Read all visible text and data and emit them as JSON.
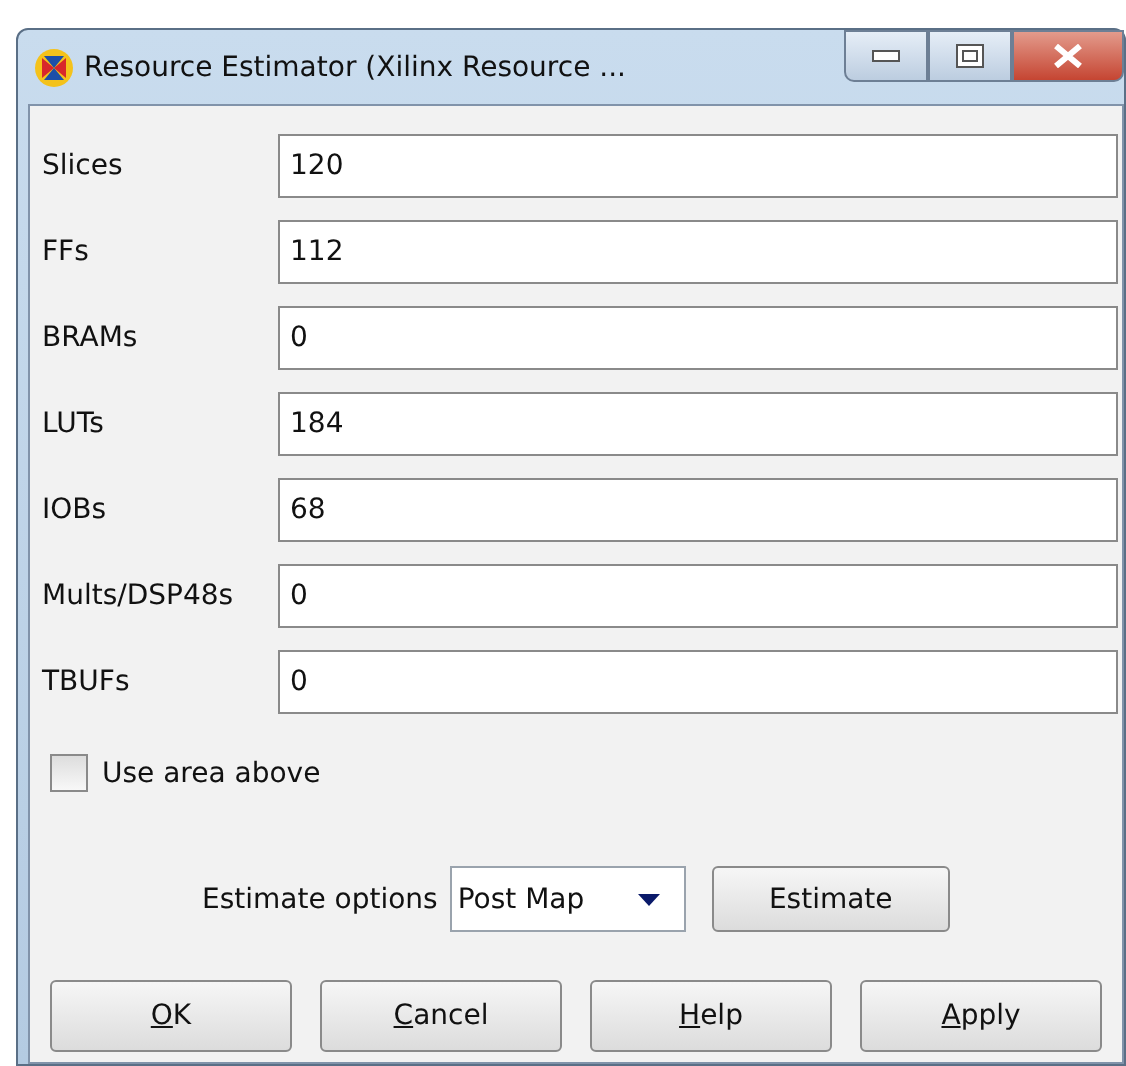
{
  "window": {
    "title": "Resource Estimator (Xilinx Resource ..."
  },
  "fields": [
    {
      "label": "Slices",
      "value": "120"
    },
    {
      "label": "FFs",
      "value": "112"
    },
    {
      "label": "BRAMs",
      "value": "0"
    },
    {
      "label": "LUTs",
      "value": "184"
    },
    {
      "label": "IOBs",
      "value": "68"
    },
    {
      "label": "Mults/DSP48s",
      "value": "0"
    },
    {
      "label": "TBUFs",
      "value": "0"
    }
  ],
  "use_area_above": {
    "label": "Use area above",
    "checked": false
  },
  "estimate_options": {
    "label": "Estimate options",
    "value": "Post Map",
    "button": "Estimate"
  },
  "buttons": [
    {
      "mnemonic": "O",
      "rest": "K"
    },
    {
      "mnemonic": "C",
      "rest": "ancel"
    },
    {
      "mnemonic": "H",
      "rest": "elp"
    },
    {
      "mnemonic": "A",
      "rest": "pply"
    }
  ]
}
